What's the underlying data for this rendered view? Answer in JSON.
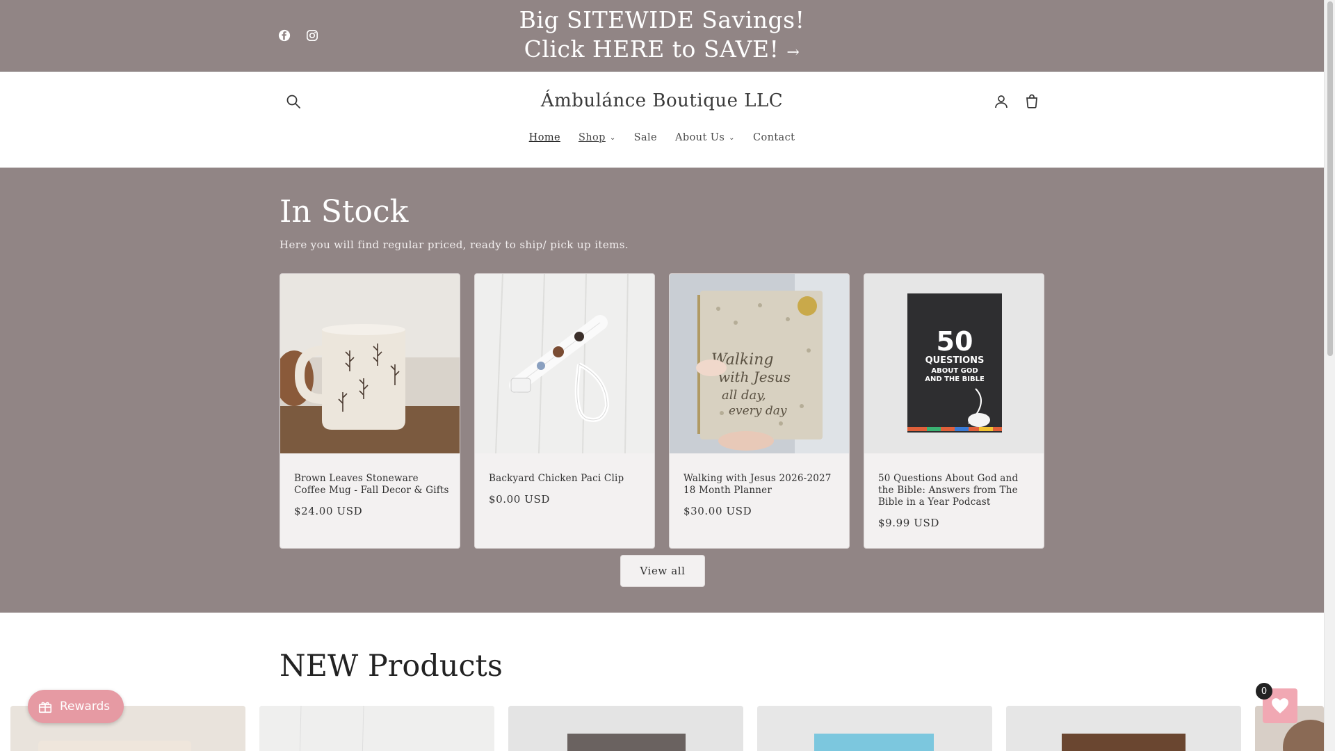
{
  "announcement": {
    "line1": "Big SITEWIDE Savings!",
    "line2": "Click HERE to SAVE!",
    "arrow": "→"
  },
  "social": [
    "facebook-icon",
    "instagram-icon"
  ],
  "header": {
    "store_name": "Ámbulánce Boutique LLC",
    "nav": [
      {
        "label": "Home",
        "active": true
      },
      {
        "label": "Shop",
        "dropdown": true
      },
      {
        "label": "Sale"
      },
      {
        "label": "About Us",
        "dropdown": true
      },
      {
        "label": "Contact"
      }
    ]
  },
  "in_stock": {
    "title": "In Stock",
    "subtitle": "Here you will find regular priced, ready to ship/ pick up items.",
    "products": [
      {
        "title": "Brown Leaves Stoneware Coffee Mug - Fall Decor & Gifts",
        "price": "$24.00 USD"
      },
      {
        "title": "Backyard Chicken Paci Clip",
        "price": "$0.00 USD"
      },
      {
        "title": "Walking with Jesus 2026-2027 18 Month Planner",
        "price": "$30.00 USD"
      },
      {
        "title": "50 Questions About God and the Bible: Answers from The Bible in a Year Podcast",
        "price": "$9.99 USD"
      }
    ],
    "view_all": "View all",
    "book_cover": {
      "number": "50",
      "line1": "QUESTIONS",
      "line2": "ABOUT GOD",
      "line3": "AND THE BIBLE"
    },
    "planner_cover": {
      "line1": "Walking",
      "line2": "with Jesus",
      "line3": "all day,",
      "line4": "every day"
    }
  },
  "new_products": {
    "title": "NEW Products"
  },
  "widgets": {
    "rewards_label": "Rewards",
    "wishlist_count": "0"
  },
  "colors": {
    "section_bg": "#918585",
    "rewards": "#e69aa3",
    "wishlist": "#f1a8b3"
  }
}
